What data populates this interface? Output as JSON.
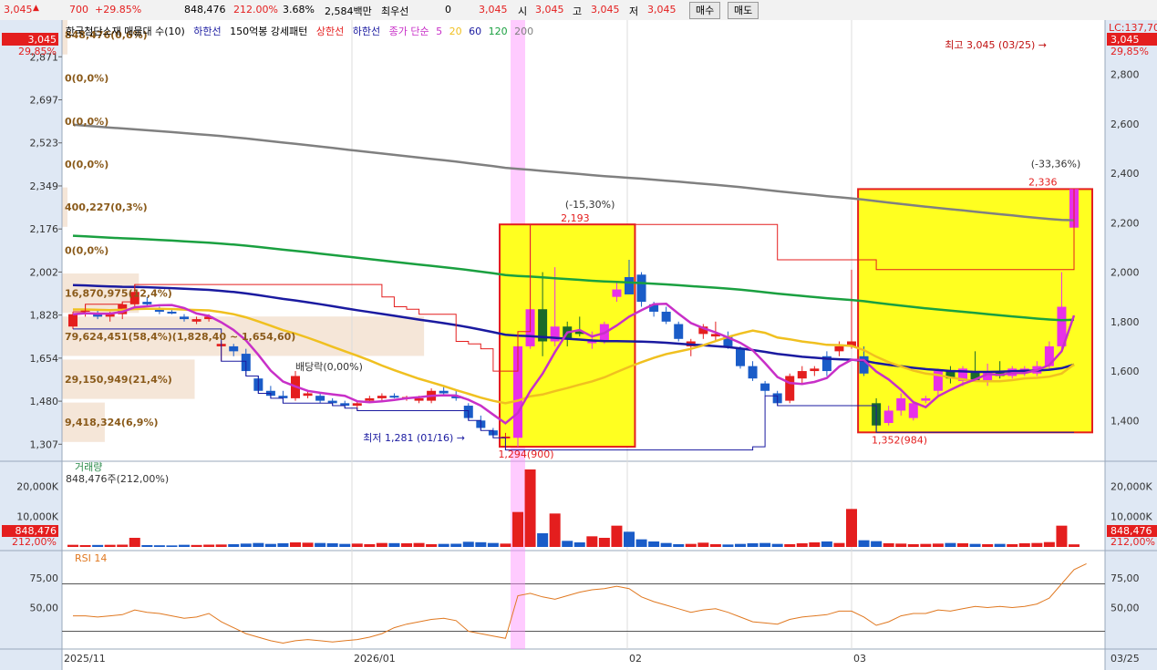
{
  "header": {
    "price": "3,045",
    "change": "700",
    "change_pct": "+29.85%",
    "volume": "848,476",
    "volume_pct": "212.00%",
    "turnover": "3.68%",
    "amount": "2,584백만",
    "best_label": "최우선",
    "best_value": "0",
    "ask": "3,045",
    "open_label": "시",
    "open": "3,045",
    "high_label": "고",
    "high": "3,045",
    "low_label": "저",
    "low": "3,045",
    "buy_label": "매수",
    "sell_label": "매도"
  },
  "legend": {
    "indicator": "한국첨단소재 매물대 수(10)",
    "lower_line": "하한선",
    "pattern": "150억봉 강세패턴",
    "upper": "상한선",
    "lower": "하한선",
    "ma_label": "종가 단순",
    "ma_periods": [
      "5",
      "20",
      "60",
      "120",
      "200"
    ],
    "colors": {
      "ma5": "#c830c8",
      "ma20": "#f0c020",
      "ma60": "#1a1aa0",
      "ma120": "#1aa040",
      "ma200": "#808080",
      "upper": "#e41e1e",
      "lower": "#1a1aa0"
    }
  },
  "labels": {
    "lc_label": "LC:137,70",
    "price_tag": "3,045",
    "pct_tag": "29,85%",
    "high_note": "최고 3,045 (03/25)",
    "low_note": "최저 1,281 (01/16)",
    "dividend_note": "배당락(0,00%)",
    "box1_high": "2,193",
    "box1_pct": "(-15,30%)",
    "box1_low": "1,294(900)",
    "box2_high": "2,336",
    "box2_pct": "(-33,36%)",
    "box2_low": "1,352(984)",
    "volume_title": "거래량",
    "volume_value": "848,476주(212,00%)",
    "volume_tag": "848,476",
    "volume_pct_tag": "212,00%",
    "rsi_title": "RSI 14"
  },
  "vol_profile": [
    {
      "label": "848,476(0,6%)",
      "price": 2960,
      "frac": 0.005
    },
    {
      "label": "0(0,0%)",
      "price": 2785,
      "frac": 0
    },
    {
      "label": "0(0,0%)",
      "price": 2610,
      "frac": 0
    },
    {
      "label": "0(0,0%)",
      "price": 2437,
      "frac": 0
    },
    {
      "label": "400,227(0,3%)",
      "price": 2263,
      "frac": 0.003
    },
    {
      "label": "0(0,0%)",
      "price": 2089,
      "frac": 0
    },
    {
      "label": "16,870,975(12,4%)",
      "price": 1915,
      "frac": 0.124
    },
    {
      "label": "79,624,451(58,4%)(1,828,40 ~ 1,654,60)",
      "price": 1741,
      "frac": 0.584
    },
    {
      "label": "29,150,949(21,4%)",
      "price": 1567,
      "frac": 0.214
    },
    {
      "label": "9,418,324(6,9%)",
      "price": 1393,
      "frac": 0.069
    }
  ],
  "chart_data": {
    "type": "candlestick",
    "price_axis_left": [
      "2,871",
      "2,697",
      "2,523",
      "2,349",
      "2,176",
      "2,002",
      "1,828",
      "1,654",
      "1,480",
      "1,307"
    ],
    "price_axis_right": [
      "2,800",
      "2,600",
      "2,400",
      "2,200",
      "2,000",
      "1,800",
      "1,600",
      "1,400"
    ],
    "volume_axis": [
      "20,000K",
      "10,000K"
    ],
    "rsi_axis": [
      "75,00",
      "50,00"
    ],
    "x_labels": [
      "2025/11",
      "2026/01",
      "02",
      "03",
      "03/25"
    ],
    "candles": [
      [
        1780,
        1840,
        1770,
        1830
      ],
      [
        1840,
        1870,
        1820,
        1850
      ],
      [
        1830,
        1850,
        1810,
        1820
      ],
      [
        1820,
        1840,
        1800,
        1830
      ],
      [
        1830,
        1880,
        1810,
        1870
      ],
      [
        1870,
        1950,
        1860,
        1920
      ],
      [
        1880,
        1900,
        1860,
        1870
      ],
      [
        1850,
        1860,
        1830,
        1840
      ],
      [
        1840,
        1850,
        1830,
        1835
      ],
      [
        1820,
        1830,
        1800,
        1810
      ],
      [
        1800,
        1820,
        1790,
        1810
      ],
      [
        1810,
        1830,
        1800,
        1820
      ],
      [
        1700,
        1720,
        1640,
        1710
      ],
      [
        1700,
        1710,
        1660,
        1680
      ],
      [
        1670,
        1690,
        1580,
        1600
      ],
      [
        1570,
        1580,
        1510,
        1520
      ],
      [
        1520,
        1540,
        1490,
        1500
      ],
      [
        1500,
        1520,
        1470,
        1490
      ],
      [
        1490,
        1600,
        1480,
        1580
      ],
      [
        1500,
        1520,
        1490,
        1510
      ],
      [
        1500,
        1510,
        1470,
        1480
      ],
      [
        1480,
        1490,
        1460,
        1470
      ],
      [
        1470,
        1480,
        1450,
        1460
      ],
      [
        1460,
        1480,
        1440,
        1470
      ],
      [
        1480,
        1500,
        1470,
        1490
      ],
      [
        1490,
        1510,
        1480,
        1500
      ],
      [
        1500,
        1510,
        1490,
        1495
      ],
      [
        1490,
        1500,
        1480,
        1495
      ],
      [
        1480,
        1500,
        1470,
        1490
      ],
      [
        1480,
        1530,
        1470,
        1520
      ],
      [
        1520,
        1540,
        1500,
        1510
      ],
      [
        1500,
        1520,
        1480,
        1490
      ],
      [
        1460,
        1470,
        1400,
        1410
      ],
      [
        1400,
        1420,
        1360,
        1370
      ],
      [
        1360,
        1370,
        1330,
        1340
      ],
      [
        1330,
        1350,
        1281,
        1335
      ],
      [
        1330,
        1760,
        1294,
        1700
      ],
      [
        1700,
        2193,
        1690,
        1850
      ],
      [
        1850,
        2000,
        1660,
        1720
      ],
      [
        1720,
        2020,
        1700,
        1780
      ],
      [
        1780,
        1800,
        1700,
        1730
      ],
      [
        1760,
        1820,
        1740,
        1750
      ],
      [
        1720,
        1760,
        1690,
        1720
      ],
      [
        1720,
        1800,
        1710,
        1790
      ],
      [
        1900,
        1960,
        1880,
        1930
      ],
      [
        1980,
        2050,
        1950,
        1910
      ],
      [
        1990,
        2000,
        1860,
        1880
      ],
      [
        1870,
        1880,
        1820,
        1840
      ],
      [
        1840,
        1860,
        1790,
        1800
      ],
      [
        1790,
        1800,
        1720,
        1730
      ],
      [
        1700,
        1730,
        1660,
        1720
      ],
      [
        1750,
        1790,
        1730,
        1780
      ],
      [
        1740,
        1800,
        1720,
        1750
      ],
      [
        1740,
        1760,
        1690,
        1700
      ],
      [
        1690,
        1700,
        1610,
        1620
      ],
      [
        1620,
        1640,
        1560,
        1570
      ],
      [
        1550,
        1560,
        1500,
        1520
      ],
      [
        1510,
        1520,
        1460,
        1470
      ],
      [
        1480,
        1590,
        1470,
        1580
      ],
      [
        1570,
        1620,
        1550,
        1600
      ],
      [
        1600,
        1620,
        1580,
        1610
      ],
      [
        1660,
        1680,
        1580,
        1600
      ],
      [
        1680,
        1720,
        1660,
        1700
      ],
      [
        1700,
        2010,
        1690,
        1720
      ],
      [
        1660,
        1700,
        1580,
        1590
      ],
      [
        1470,
        1490,
        1352,
        1380
      ],
      [
        1390,
        1460,
        1380,
        1440
      ],
      [
        1440,
        1510,
        1420,
        1490
      ],
      [
        1410,
        1480,
        1400,
        1470
      ],
      [
        1480,
        1500,
        1470,
        1490
      ],
      [
        1520,
        1610,
        1500,
        1600
      ],
      [
        1600,
        1620,
        1550,
        1570
      ],
      [
        1560,
        1620,
        1540,
        1610
      ],
      [
        1600,
        1680,
        1580,
        1560
      ],
      [
        1560,
        1630,
        1540,
        1600
      ],
      [
        1600,
        1640,
        1570,
        1580
      ],
      [
        1580,
        1620,
        1570,
        1610
      ],
      [
        1600,
        1620,
        1580,
        1610
      ],
      [
        1590,
        1640,
        1580,
        1620
      ],
      [
        1620,
        1720,
        1610,
        1700
      ],
      [
        1700,
        2000,
        1690,
        1860
      ],
      [
        2180,
        2336,
        2050,
        2336
      ]
    ],
    "volume_k": [
      700,
      600,
      650,
      700,
      750,
      3000,
      600,
      550,
      500,
      700,
      650,
      750,
      800,
      900,
      1100,
      1300,
      1000,
      1200,
      1500,
      1400,
      1300,
      1200,
      1000,
      1100,
      900,
      1300,
      1250,
      1200,
      1300,
      900,
      1000,
      1050,
      1700,
      1550,
      1300,
      1100,
      11500,
      25500,
      4500,
      11000,
      2000,
      1500,
      3500,
      3000,
      7000,
      5000,
      2500,
      1800,
      1300,
      900,
      1000,
      1400,
      900,
      800,
      1000,
      1200,
      1300,
      1000,
      900,
      1200,
      1500,
      1800,
      1300,
      12500,
      2200,
      1900,
      1200,
      1100,
      900,
      1000,
      1100,
      1300,
      1200,
      1000,
      900,
      1000,
      900,
      1200,
      1300,
      1600,
      7000,
      848
    ],
    "rsi": [
      43,
      43,
      42,
      43,
      44,
      48,
      46,
      45,
      43,
      41,
      42,
      45,
      38,
      33,
      28,
      25,
      22,
      20,
      22,
      23,
      22,
      21,
      22,
      23,
      25,
      28,
      33,
      36,
      38,
      40,
      41,
      39,
      30,
      28,
      26,
      24,
      60,
      62,
      59,
      57,
      60,
      63,
      65,
      66,
      68,
      66,
      59,
      55,
      52,
      49,
      46,
      48,
      49,
      46,
      42,
      38,
      37,
      36,
      40,
      42,
      43,
      44,
      47,
      47,
      42,
      35,
      38,
      43,
      45,
      45,
      48,
      47,
      49,
      51,
      50,
      51,
      50,
      51,
      53,
      58,
      70,
      82,
      87
    ]
  }
}
